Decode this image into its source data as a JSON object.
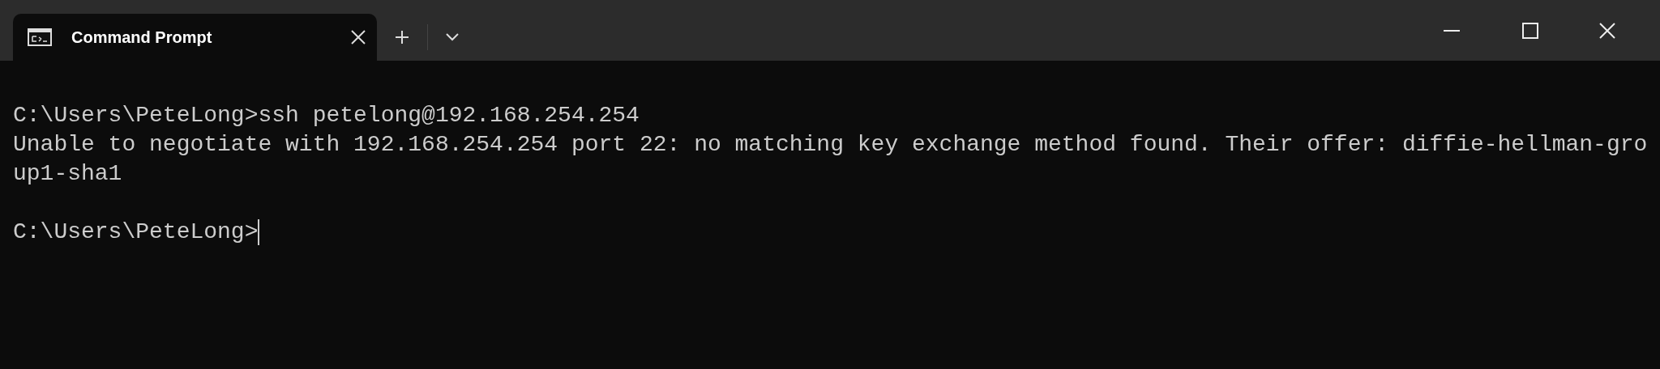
{
  "tab": {
    "title": "Command Prompt",
    "selected": true
  },
  "terminal": {
    "blocks": [
      {
        "lines": [
          {
            "text": "C:\\Users\\PeteLong>ssh petelong@192.168.254.254",
            "cursor": false
          },
          {
            "text": "Unable to negotiate with 192.168.254.254 port 22: no matching key exchange method found. Their offer: diffie-hellman-gro",
            "cursor": false
          },
          {
            "text": "up1-sha1",
            "cursor": false
          }
        ]
      },
      {
        "lines": [
          {
            "text": "C:\\Users\\PeteLong>",
            "cursor": true
          }
        ]
      }
    ]
  }
}
